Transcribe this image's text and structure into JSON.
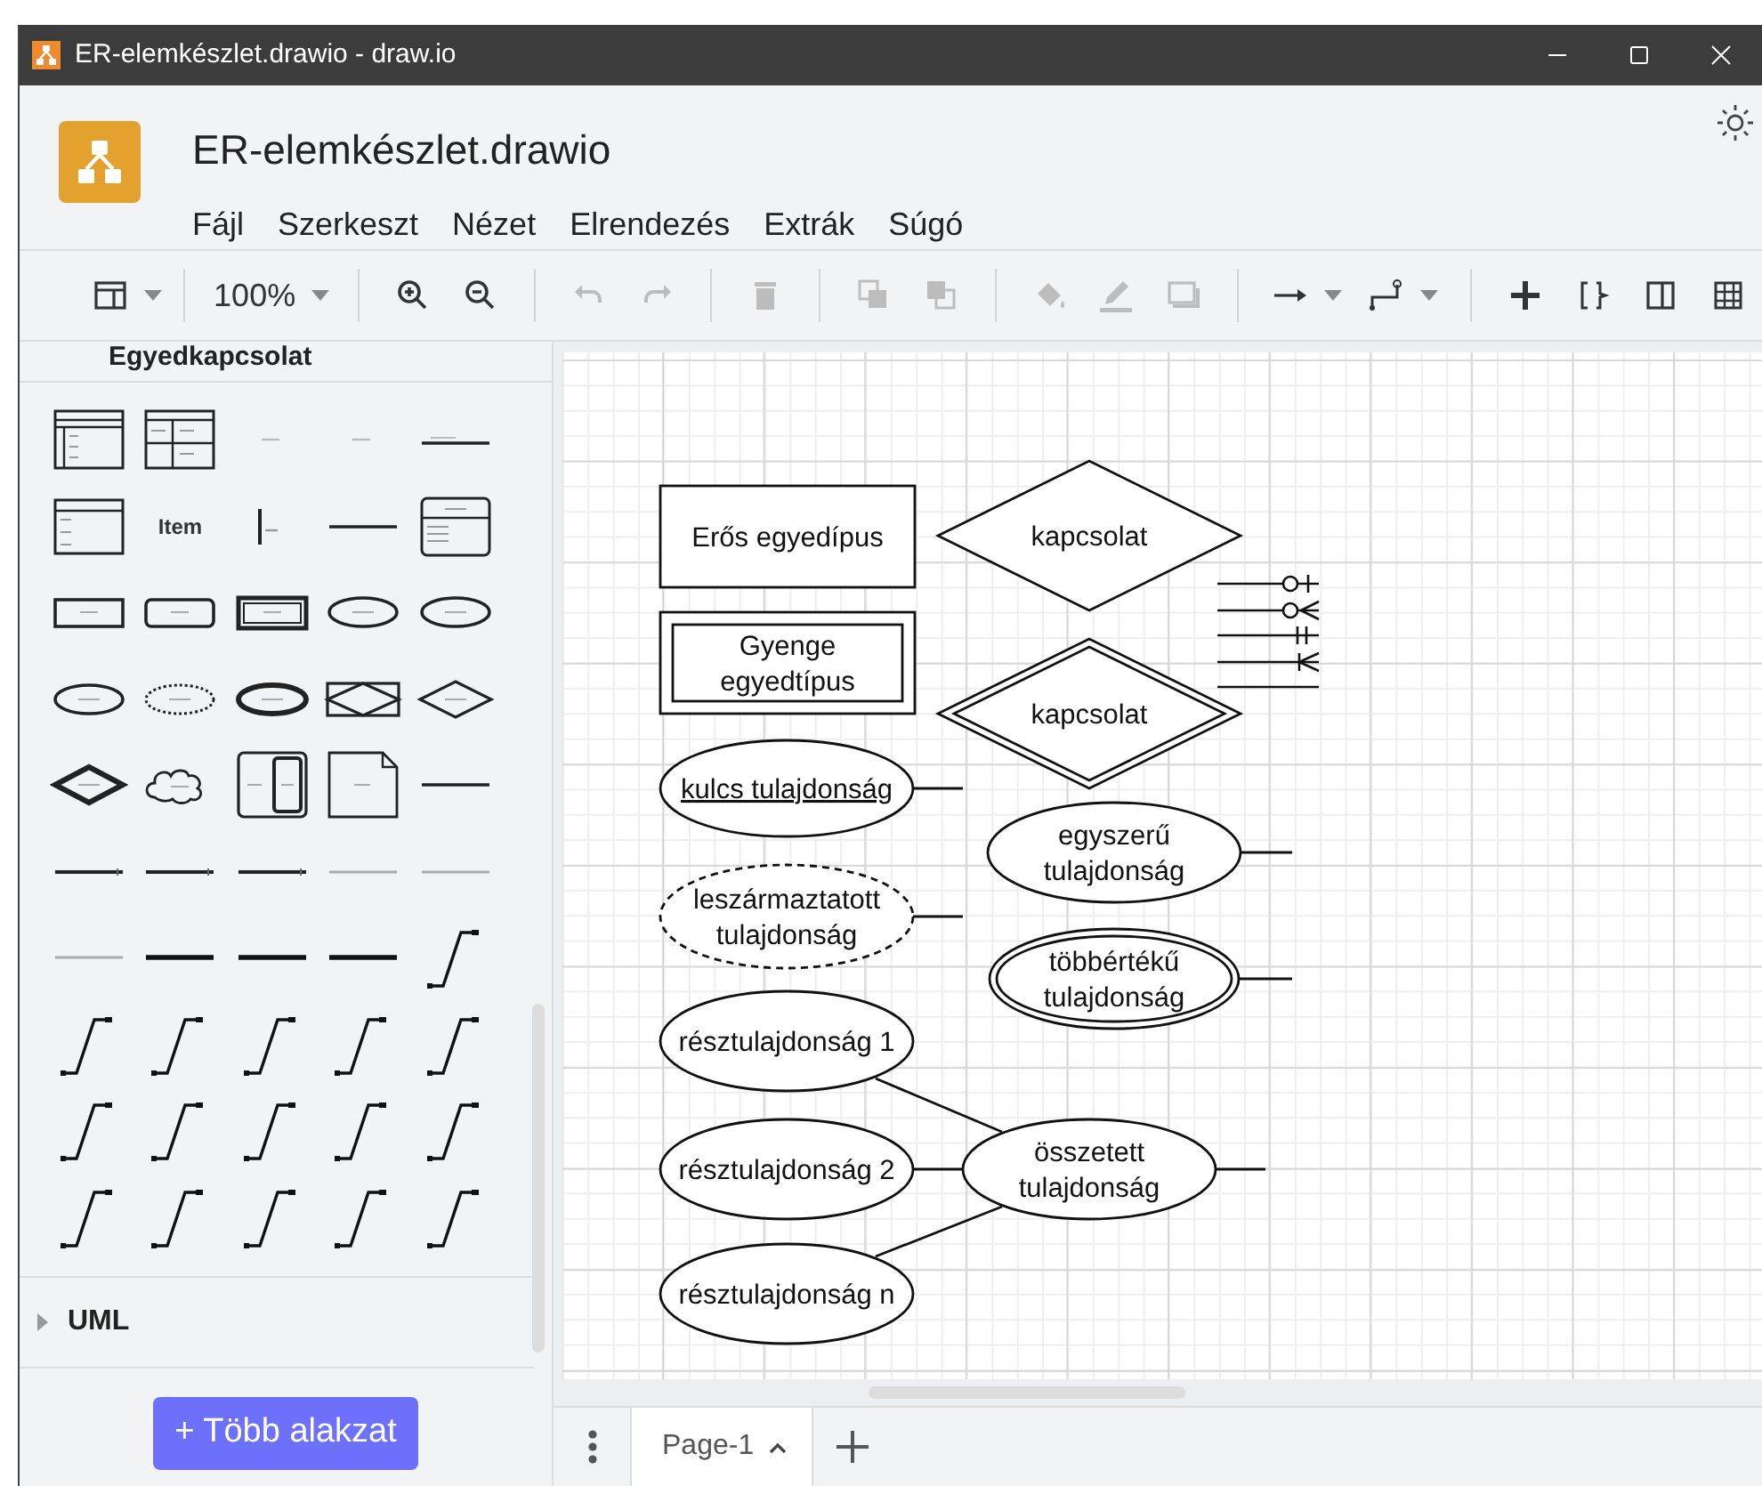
{
  "window": {
    "title": "ER-elemkészlet.drawio - draw.io"
  },
  "header": {
    "file_name": "ER-elemkészlet.drawio",
    "menu": [
      "Fájl",
      "Szerkeszt",
      "Nézet",
      "Elrendezés",
      "Extrák",
      "Súgó"
    ]
  },
  "toolbar": [
    {
      "kind": "layout",
      "caret": true,
      "disabled": false
    },
    {
      "kind": "separator"
    },
    {
      "kind": "zoom-level",
      "text": "100%",
      "caret": true,
      "disabled": false
    },
    {
      "kind": "separator"
    },
    {
      "kind": "zoom-in",
      "caret": false,
      "disabled": false
    },
    {
      "kind": "zoom-out",
      "caret": false,
      "disabled": false
    },
    {
      "kind": "separator"
    },
    {
      "kind": "undo",
      "caret": false,
      "disabled": true
    },
    {
      "kind": "redo",
      "caret": false,
      "disabled": true
    },
    {
      "kind": "separator"
    },
    {
      "kind": "delete",
      "caret": false,
      "disabled": true
    },
    {
      "kind": "separator"
    },
    {
      "kind": "to-front",
      "caret": false,
      "disabled": true
    },
    {
      "kind": "to-back",
      "caret": false,
      "disabled": true
    },
    {
      "kind": "separator"
    },
    {
      "kind": "fill",
      "caret": false,
      "disabled": true
    },
    {
      "kind": "line-color",
      "caret": false,
      "disabled": true
    },
    {
      "kind": "shadow",
      "caret": false,
      "disabled": true
    },
    {
      "kind": "separator"
    },
    {
      "kind": "connection",
      "caret": true,
      "disabled": false
    },
    {
      "kind": "waypoints",
      "caret": true,
      "disabled": false
    },
    {
      "kind": "separator"
    },
    {
      "kind": "insert",
      "caret": false,
      "disabled": false
    },
    {
      "kind": "bracket",
      "caret": false,
      "disabled": false
    },
    {
      "kind": "panel",
      "caret": false,
      "disabled": false
    },
    {
      "kind": "table",
      "caret": false,
      "disabled": false
    }
  ],
  "sidebar": {
    "section_title": "Egyedkapcsolat",
    "shapes": [
      {
        "kind": "table"
      },
      {
        "kind": "table2"
      },
      {
        "kind": "tiny-label"
      },
      {
        "kind": "tiny-label"
      },
      {
        "kind": "labeled-line"
      },
      {
        "kind": "list-table"
      },
      {
        "kind": "item-text",
        "label": "Item"
      },
      {
        "kind": "item-bar"
      },
      {
        "kind": "line"
      },
      {
        "kind": "entity-attrs"
      },
      {
        "kind": "entity"
      },
      {
        "kind": "entity-round"
      },
      {
        "kind": "entity-double"
      },
      {
        "kind": "attribute"
      },
      {
        "kind": "attribute"
      },
      {
        "kind": "attribute"
      },
      {
        "kind": "attribute-dashed"
      },
      {
        "kind": "attribute-bold"
      },
      {
        "kind": "assoc"
      },
      {
        "kind": "relationship"
      },
      {
        "kind": "relationship-bold"
      },
      {
        "kind": "cloud"
      },
      {
        "kind": "split"
      },
      {
        "kind": "note"
      },
      {
        "kind": "line"
      },
      {
        "kind": "line-arrow"
      },
      {
        "kind": "line-arrow"
      },
      {
        "kind": "line-arrow"
      },
      {
        "kind": "line-light"
      },
      {
        "kind": "line-light"
      },
      {
        "kind": "line-light"
      },
      {
        "kind": "line-bold"
      },
      {
        "kind": "line-bold"
      },
      {
        "kind": "line-bold"
      },
      {
        "kind": "connector"
      },
      {
        "kind": "connector"
      },
      {
        "kind": "connector"
      },
      {
        "kind": "connector"
      },
      {
        "kind": "connector"
      },
      {
        "kind": "connector"
      },
      {
        "kind": "connector"
      },
      {
        "kind": "connector"
      },
      {
        "kind": "connector"
      },
      {
        "kind": "connector"
      },
      {
        "kind": "connector"
      },
      {
        "kind": "connector"
      },
      {
        "kind": "connector"
      },
      {
        "kind": "connector"
      },
      {
        "kind": "connector"
      },
      {
        "kind": "connector"
      }
    ],
    "collapsed_sections": [
      {
        "title": "UML",
        "expanded": false
      }
    ],
    "more_shapes_button": "+ Több alakzat"
  },
  "diagram": {
    "shapes": [
      {
        "kind": "entity",
        "lines": [
          "Erős egyedípus"
        ]
      },
      {
        "kind": "relationship",
        "lines": [
          "kapcsolat"
        ]
      },
      {
        "kind": "weak-entity",
        "lines": [
          "Gyenge",
          "egyedtípus"
        ]
      },
      {
        "kind": "weak-relationship",
        "lines": [
          "kapcsolat"
        ]
      },
      {
        "kind": "key-attribute",
        "lines": [
          "kulcs tulajdonság"
        ]
      },
      {
        "kind": "attribute",
        "lines": [
          "egyszerű",
          "tulajdonság"
        ]
      },
      {
        "kind": "derived-attribute",
        "lines": [
          "leszármaztatott",
          "tulajdonság"
        ]
      },
      {
        "kind": "multivalued-attribute",
        "lines": [
          "többértékű",
          "tulajdonság"
        ]
      },
      {
        "kind": "attribute",
        "lines": [
          "résztulajdonság 1"
        ]
      },
      {
        "kind": "attribute",
        "lines": [
          "résztulajdonság 2"
        ]
      },
      {
        "kind": "attribute",
        "lines": [
          "összetett",
          "tulajdonság"
        ]
      },
      {
        "kind": "attribute",
        "lines": [
          "résztulajdonság n"
        ]
      }
    ],
    "notation_lines": [
      {
        "kind": "zero-or-one"
      },
      {
        "kind": "zero-or-many"
      },
      {
        "kind": "exactly-one"
      },
      {
        "kind": "one-or-many"
      },
      {
        "kind": "plain"
      }
    ]
  },
  "pages": {
    "tabs": [
      {
        "label": "Page-1",
        "selected": true
      }
    ]
  }
}
